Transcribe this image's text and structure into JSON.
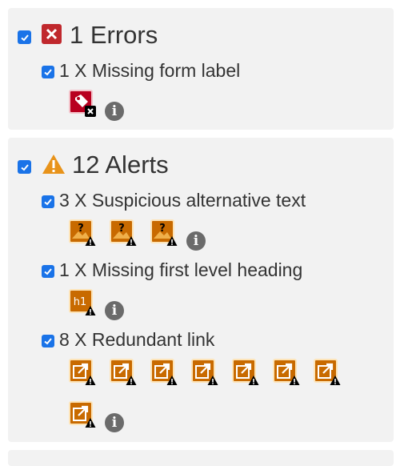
{
  "errors": {
    "title": "1 Errors",
    "items": [
      {
        "label": "1 X Missing form label",
        "icon_count": 1,
        "icon": "tag-icon",
        "badge": "error-badge"
      }
    ]
  },
  "alerts": {
    "title": "12 Alerts",
    "items": [
      {
        "label": "3 X Suspicious alternative text",
        "icon_count": 3,
        "icon": "question-image-icon",
        "glyph_text": "?"
      },
      {
        "label": "1 X Missing first level heading",
        "icon_count": 1,
        "icon": "h1-icon",
        "glyph_text": "h1"
      },
      {
        "label": "8 X Redundant link",
        "icon_count": 8,
        "icon": "link-icon"
      }
    ]
  },
  "colors": {
    "accent": "#1a73e8",
    "error": "#c0282d",
    "alert": "#c86a00",
    "alert_triangle": "#e8931a",
    "panel_bg": "#f2f2f2",
    "info": "#6b6b6b"
  }
}
